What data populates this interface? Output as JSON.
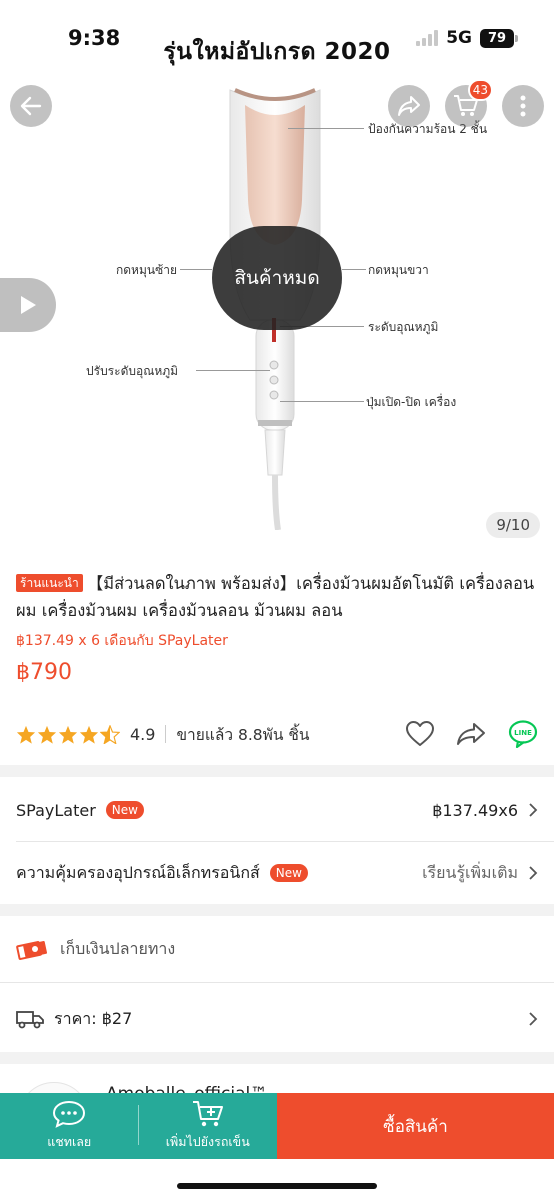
{
  "status_bar": {
    "time": "9:38",
    "network": "5G",
    "battery": "79"
  },
  "hero": {
    "banner_title": "รุ่นใหม่อัปเกรด 2020",
    "cart_count": "43",
    "sold_out_label": "สินค้าหมด",
    "image_counter": "9/10",
    "annotations": {
      "heat_protection": "ป้องกันความร้อน 2 ชั้น",
      "rotate_left": "กดหมุนซ้าย",
      "rotate_right": "กดหมุนขวา",
      "temp_level": "ระดับอุณหภูมิ",
      "adjust_temp": "ปรับระดับอุณหภูมิ",
      "power_button": "ปุ่มเปิด-ปิด เครื่อง"
    }
  },
  "product": {
    "shop_badge": "ร้านแนะนำ",
    "title": "【มีส่วนลดในภาพ พร้อมส่ง】เครื่องม้วนผมอัตโนมัติ เครื่องลอนผม เครื่องม้วนผม เครื่องม้วนลอน ม้วนผม ลอน",
    "installment": "฿137.49 x 6 เดือนกับ SPayLater",
    "price": "฿790",
    "rating": "4.9",
    "sold": "ขายแล้ว 8.8พัน ชิ้น",
    "rating_stars": 4.5
  },
  "rows": {
    "spaylater_label": "SPayLater",
    "spaylater_badge": "New",
    "spaylater_value": "฿137.49x6",
    "protection_label": "ความคุ้มครองอุปกรณ์อิเล็กทรอนิกส์",
    "protection_badge": "New",
    "protection_value": "เรียนรู้เพิ่มเติม",
    "cod_label": "เก็บเงินปลายทาง",
    "shipping_label": "ราคา: ฿27"
  },
  "shop": {
    "name": "Amoballe_official™"
  },
  "bottom_bar": {
    "chat_label": "แชทเลย",
    "add_cart_label": "เพิ่มไปยังรถเข็น",
    "buy_label": "ซื้อสินค้า"
  },
  "colors": {
    "accent": "#ee4d2d",
    "teal": "#26aa99",
    "star": "#f5a623",
    "line_green": "#06c755"
  }
}
